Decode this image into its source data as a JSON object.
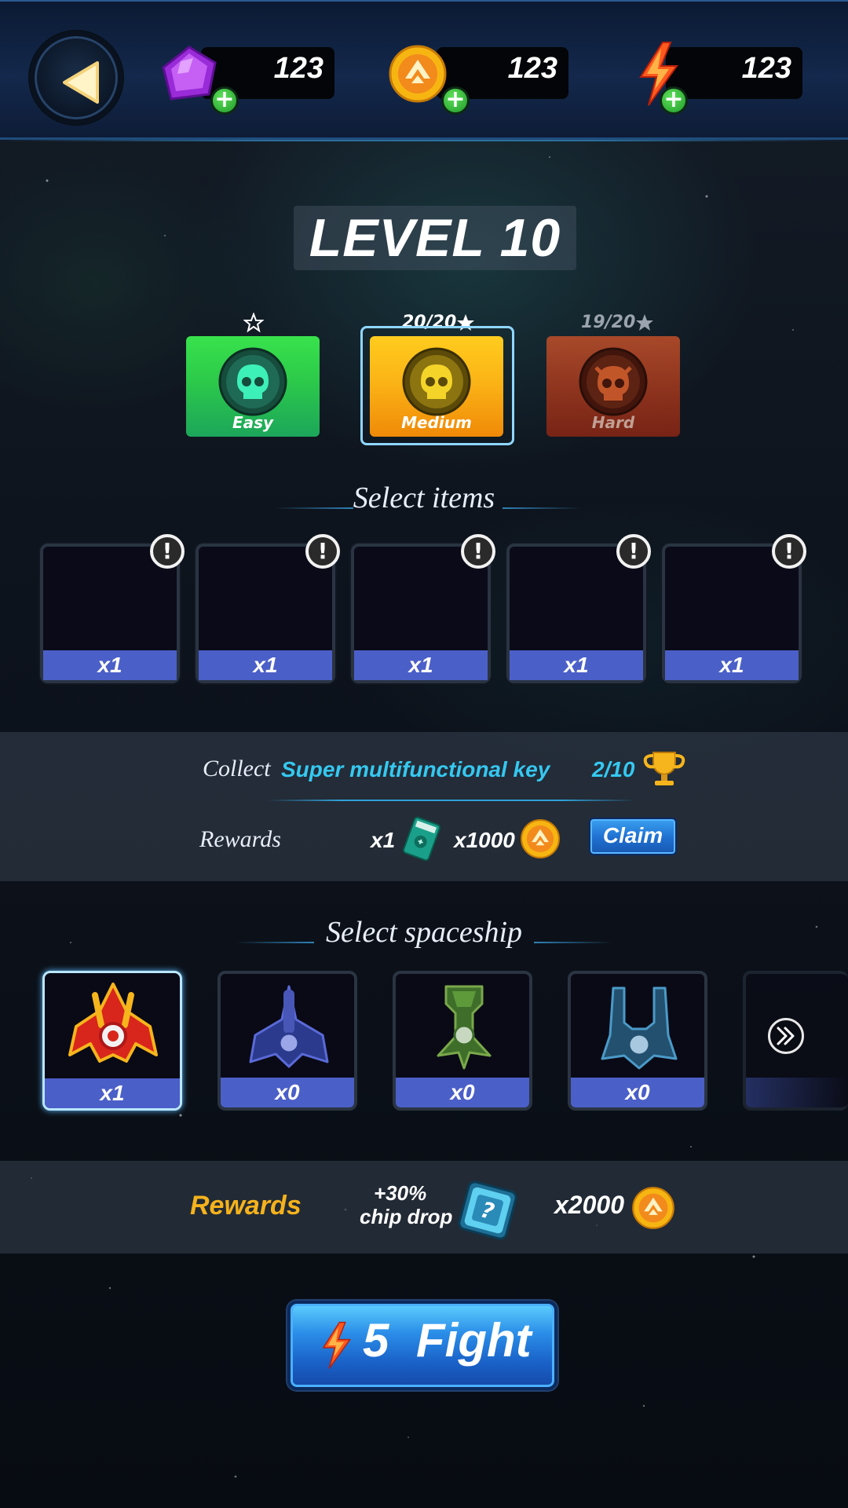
{
  "header": {
    "gems": "123",
    "coins": "123",
    "energy": "123"
  },
  "level": {
    "title": "LEVEL 10"
  },
  "difficulty": [
    {
      "name": "Easy",
      "stars": "",
      "color": "#2fd44a"
    },
    {
      "name": "Medium",
      "stars": "20/20",
      "color": "#f7a712",
      "selected": true
    },
    {
      "name": "Hard",
      "stars": "19/20",
      "color": "#b23a1c"
    }
  ],
  "items_section": {
    "title": "Select items",
    "slots": [
      "x1",
      "x1",
      "x1",
      "x1",
      "x1"
    ]
  },
  "collect": {
    "label": "Collect",
    "target": "Super multifunctional key",
    "progress": "2/10",
    "rewards_label": "Rewards",
    "reward_item_count": "x1",
    "reward_coins": "x1000",
    "claim_label": "Claim"
  },
  "ship_section": {
    "title": "Select spaceship",
    "ships": [
      "x1",
      "x0",
      "x0",
      "x0"
    ]
  },
  "ship_rewards": {
    "label": "Rewards",
    "bonus_line1": "+30%",
    "bonus_line2": "chip drop",
    "coins": "x2000"
  },
  "fight": {
    "energy_cost": "5",
    "label": "Fight"
  },
  "colors": {
    "accent_cyan": "#35c8f0",
    "reward_gold": "#f5b21c",
    "slot_blue": "#4b5fc8"
  }
}
